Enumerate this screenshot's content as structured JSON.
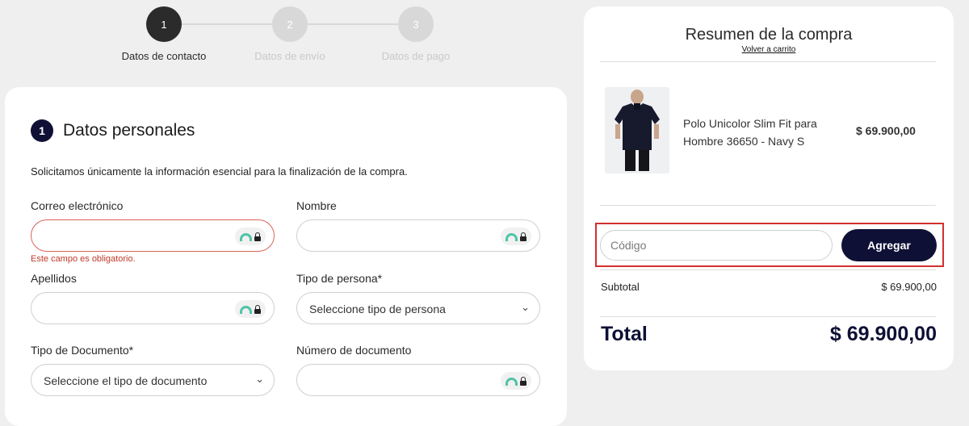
{
  "stepper": {
    "steps": [
      {
        "number": "1",
        "label": "Datos de contacto",
        "state": "active"
      },
      {
        "number": "2",
        "label": "Datos de envío",
        "state": "inactive"
      },
      {
        "number": "3",
        "label": "Datos de pago",
        "state": "inactive"
      }
    ]
  },
  "personal": {
    "badge": "1",
    "title": "Datos personales",
    "intro": "Solicitamos únicamente la información esencial para la finalización de la compra.",
    "email": {
      "label": "Correo electrónico",
      "value": "",
      "error": "Este campo es obligatorio."
    },
    "name": {
      "label": "Nombre",
      "value": ""
    },
    "surname": {
      "label": "Apellidos",
      "value": ""
    },
    "person_type": {
      "label": "Tipo de persona*",
      "selected": "Seleccione tipo de persona"
    },
    "doc_type": {
      "label": "Tipo de Documento*",
      "selected": "Seleccione el tipo de documento"
    },
    "doc_number": {
      "label": "Número de documento",
      "value": ""
    }
  },
  "summary": {
    "title": "Resumen de la compra",
    "back_link": "Volver a carrito",
    "product": {
      "name": "Polo Unicolor Slim Fit para Hombre 36650 - Navy S",
      "price": "$ 69.900,00"
    },
    "promo": {
      "placeholder": "Código",
      "button": "Agregar"
    },
    "subtotal_label": "Subtotal",
    "subtotal_value": "$ 69.900,00",
    "total_label": "Total",
    "total_value": "$ 69.900,00"
  },
  "colors": {
    "brand_navy": "#0e1035",
    "error_red": "#d32f2f",
    "lock_teal": "#4fc3a9"
  },
  "icons": {
    "lock": "lock-icon",
    "chevron": "chevron-down-icon"
  }
}
